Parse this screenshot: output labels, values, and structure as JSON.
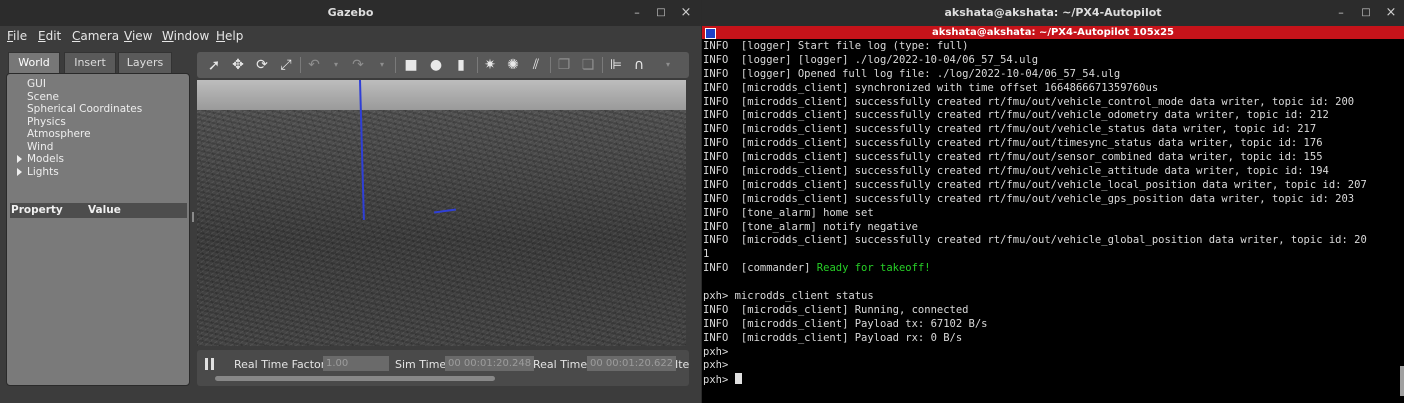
{
  "gazebo": {
    "title": "Gazebo",
    "controls": {
      "minimize": "–",
      "maximize": "□",
      "close": "×"
    },
    "menu": [
      {
        "key": "F",
        "rest": "ile"
      },
      {
        "key": "E",
        "rest": "dit"
      },
      {
        "key": "C",
        "rest": "amera"
      },
      {
        "key": "V",
        "rest": "iew"
      },
      {
        "key": "W",
        "rest": "indow"
      },
      {
        "key": "H",
        "rest": "elp"
      }
    ],
    "tabs": [
      "World",
      "Insert",
      "Layers"
    ],
    "tree": [
      "GUI",
      "Scene",
      "Spherical Coordinates",
      "Physics",
      "Atmosphere",
      "Wind",
      "Models",
      "Lights"
    ],
    "property_header": {
      "property": "Property",
      "value": "Value"
    },
    "bottom": {
      "rtf_label": "Real Time Factor:",
      "rtf_value": "1.00",
      "sim_label": "Sim Time:",
      "sim_value": "00 00:01:20.248",
      "real_label": "Real Time:",
      "real_value": "00 00:01:20.622",
      "iter_label": "Ite"
    }
  },
  "terminal": {
    "title": "akshata@akshata: ~/PX4-Autopilot",
    "tab_title": "akshata@akshata: ~/PX4-Autopilot 105x25",
    "controls": {
      "minimize": "–",
      "maximize": "□",
      "close": "×"
    },
    "lines": [
      "INFO  [logger] Start file log (type: full)",
      "INFO  [logger] [logger] ./log/2022-10-04/06_57_54.ulg",
      "INFO  [logger] Opened full log file: ./log/2022-10-04/06_57_54.ulg",
      "INFO  [microdds_client] synchronized with time offset 1664866671359760us",
      "INFO  [microdds_client] successfully created rt/fmu/out/vehicle_control_mode data writer, topic id: 200",
      "INFO  [microdds_client] successfully created rt/fmu/out/vehicle_odometry data writer, topic id: 212",
      "INFO  [microdds_client] successfully created rt/fmu/out/vehicle_status data writer, topic id: 217",
      "INFO  [microdds_client] successfully created rt/fmu/out/timesync_status data writer, topic id: 176",
      "INFO  [microdds_client] successfully created rt/fmu/out/sensor_combined data writer, topic id: 155",
      "INFO  [microdds_client] successfully created rt/fmu/out/vehicle_attitude data writer, topic id: 194",
      "INFO  [microdds_client] successfully created rt/fmu/out/vehicle_local_position data writer, topic id: 207",
      "INFO  [microdds_client] successfully created rt/fmu/out/vehicle_gps_position data writer, topic id: 203",
      "INFO  [tone_alarm] home set",
      "INFO  [tone_alarm] notify negative",
      "INFO  [microdds_client] successfully created rt/fmu/out/vehicle_global_position data writer, topic id: 20",
      "1",
      "INFO  [commander] ",
      "",
      "pxh> microdds_client status",
      "INFO  [microdds_client] Running, connected",
      "INFO  [microdds_client] Payload tx: 67102 B/s",
      "INFO  [microdds_client] Payload rx: 0 B/s",
      "pxh> ",
      "pxh> ",
      "pxh> "
    ],
    "ready_text": "Ready for takeoff!"
  }
}
